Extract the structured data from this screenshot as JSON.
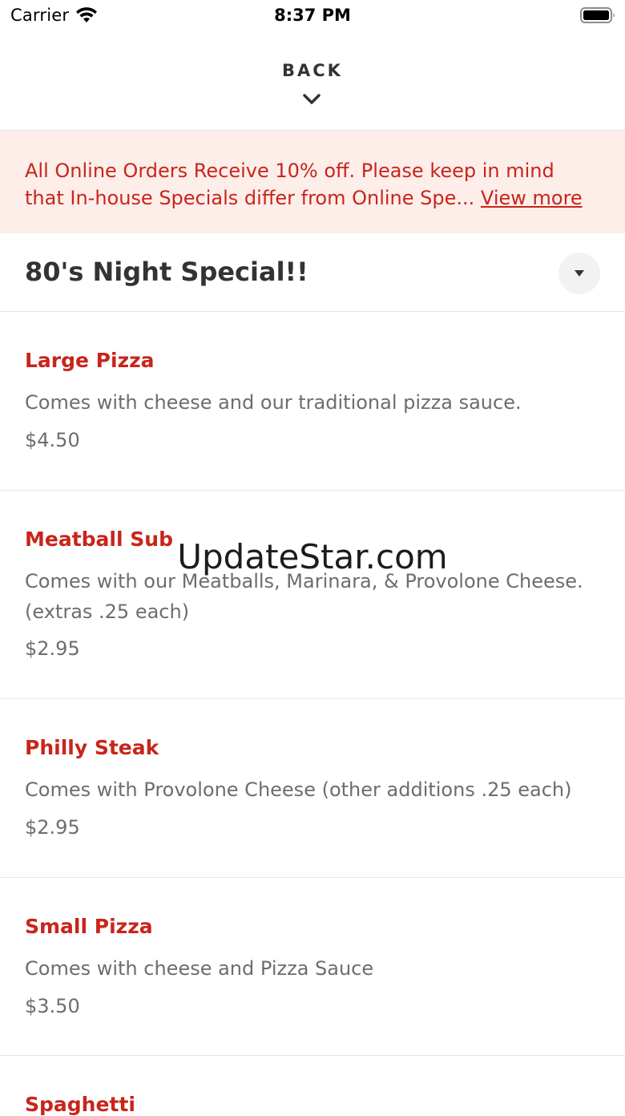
{
  "status_bar": {
    "carrier": "Carrier",
    "time": "8:37 PM"
  },
  "header": {
    "back_label": "BACK",
    "chevron_icon": "chevron-down-icon"
  },
  "banner": {
    "line1": "All Online Orders Receive 10% off. Please keep in mind",
    "line2": "that In-house Specials differ from Online Spe...",
    "link": "View more"
  },
  "section": {
    "title": "80's Night Special!!",
    "toggle_icon": "caret-down-icon"
  },
  "items": [
    {
      "name": "Large Pizza",
      "description": "Comes with cheese and our traditional pizza sauce.",
      "price": "$4.50"
    },
    {
      "name": "Meatball Sub",
      "description": "Comes with our Meatballs, Marinara, & Provolone Cheese. (extras .25 each)",
      "price": "$2.95"
    },
    {
      "name": "Philly Steak",
      "description": "Comes with Provolone Cheese (other additions .25 each)",
      "price": "$2.95"
    },
    {
      "name": "Small Pizza",
      "description": "Comes with cheese and Pizza Sauce",
      "price": "$3.50"
    },
    {
      "name": "Spaghetti"
    }
  ],
  "watermark": "UpdateStar.com",
  "colors": {
    "accent": "#c8251b",
    "banner_bg": "#fdeeea",
    "muted_text": "#6d6d6d"
  }
}
